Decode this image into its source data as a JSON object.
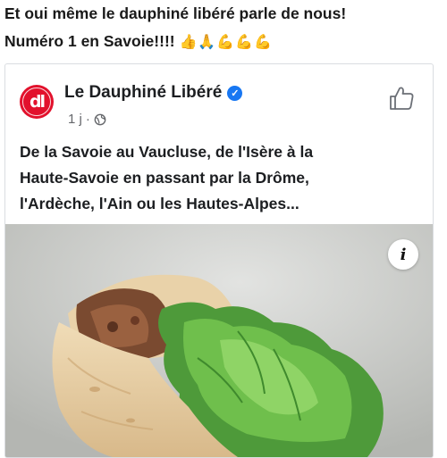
{
  "post": {
    "line1": "Et oui même le dauphiné libéré parle de nous!",
    "line2": "Numéro 1 en Savoie!!!!",
    "emojis": "👍🙏💪💪💪"
  },
  "card": {
    "avatar_text": "dl",
    "page_name": "Le Dauphiné Libéré",
    "verified_glyph": "✓",
    "time": "1 j",
    "separator": "·",
    "privacy_icon": "globe-icon",
    "like_icon": "thumbs-up-icon",
    "text_lines": [
      "De la Savoie au Vaucluse, de l'Isère à la",
      "Haute-Savoie en passant par la Drôme,",
      "l'Ardèche, l'Ain ou les Hautes-Alpes..."
    ],
    "info_glyph": "i",
    "colors": {
      "brand_red": "#e2112c",
      "verified_blue": "#1877f2"
    }
  }
}
